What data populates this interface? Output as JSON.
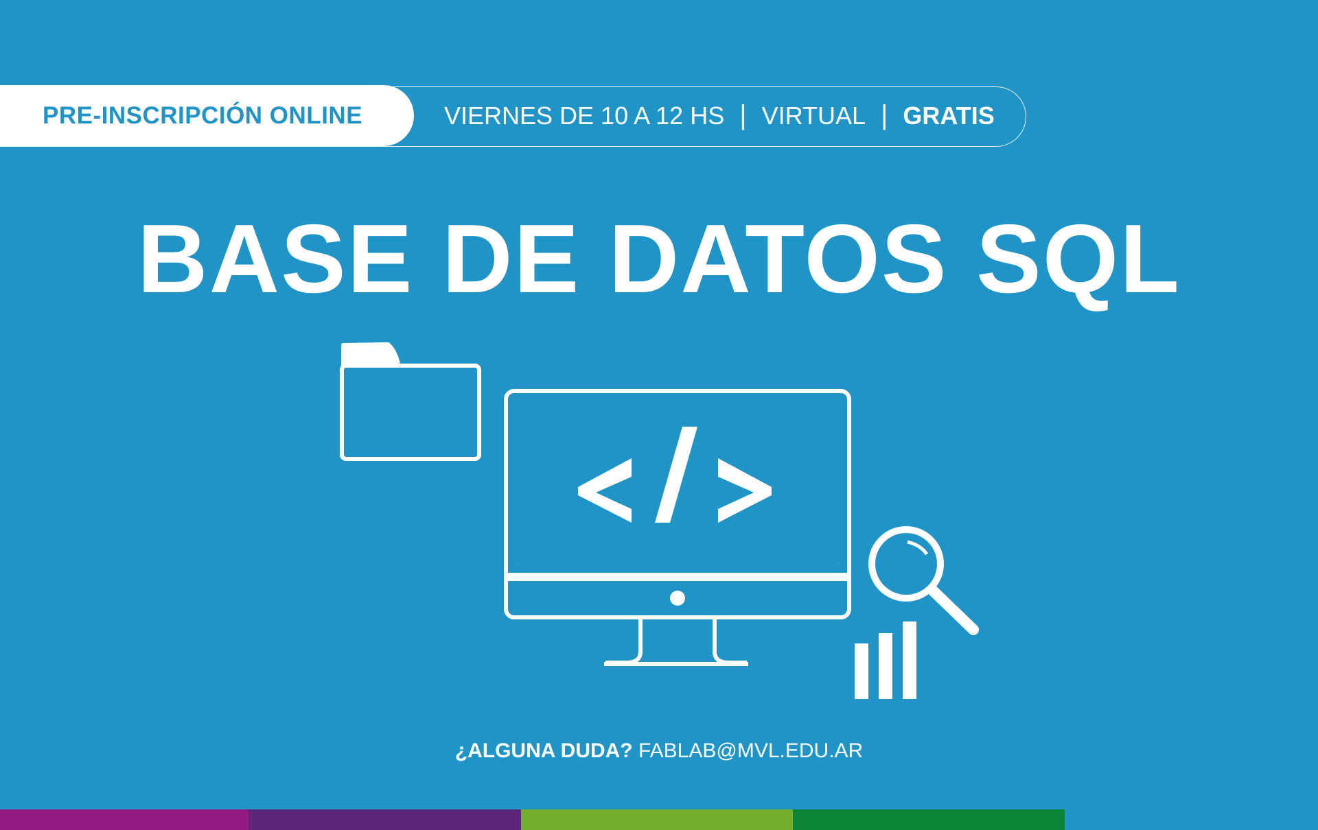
{
  "banner": {
    "registration_label": "PRE-INSCRIPCIÓN ONLINE",
    "schedule": "VIERNES DE 10 A 12 HS",
    "separator": "|",
    "mode": "VIRTUAL",
    "price": "GRATIS"
  },
  "title": "BASE DE DATOS SQL",
  "illustration": {
    "code_symbol": "</>",
    "icons": [
      "folder-icon",
      "monitor-icon",
      "magnifier-icon",
      "bar-chart-icon"
    ]
  },
  "footer": {
    "question": "¿ALGUNA DUDA?",
    "email": "FABLAB@MVL.EDU.AR"
  },
  "colors": {
    "background": "#2094c6",
    "strip": [
      "#921c81",
      "#5d2679",
      "#72af2c",
      "#0c8437"
    ]
  }
}
